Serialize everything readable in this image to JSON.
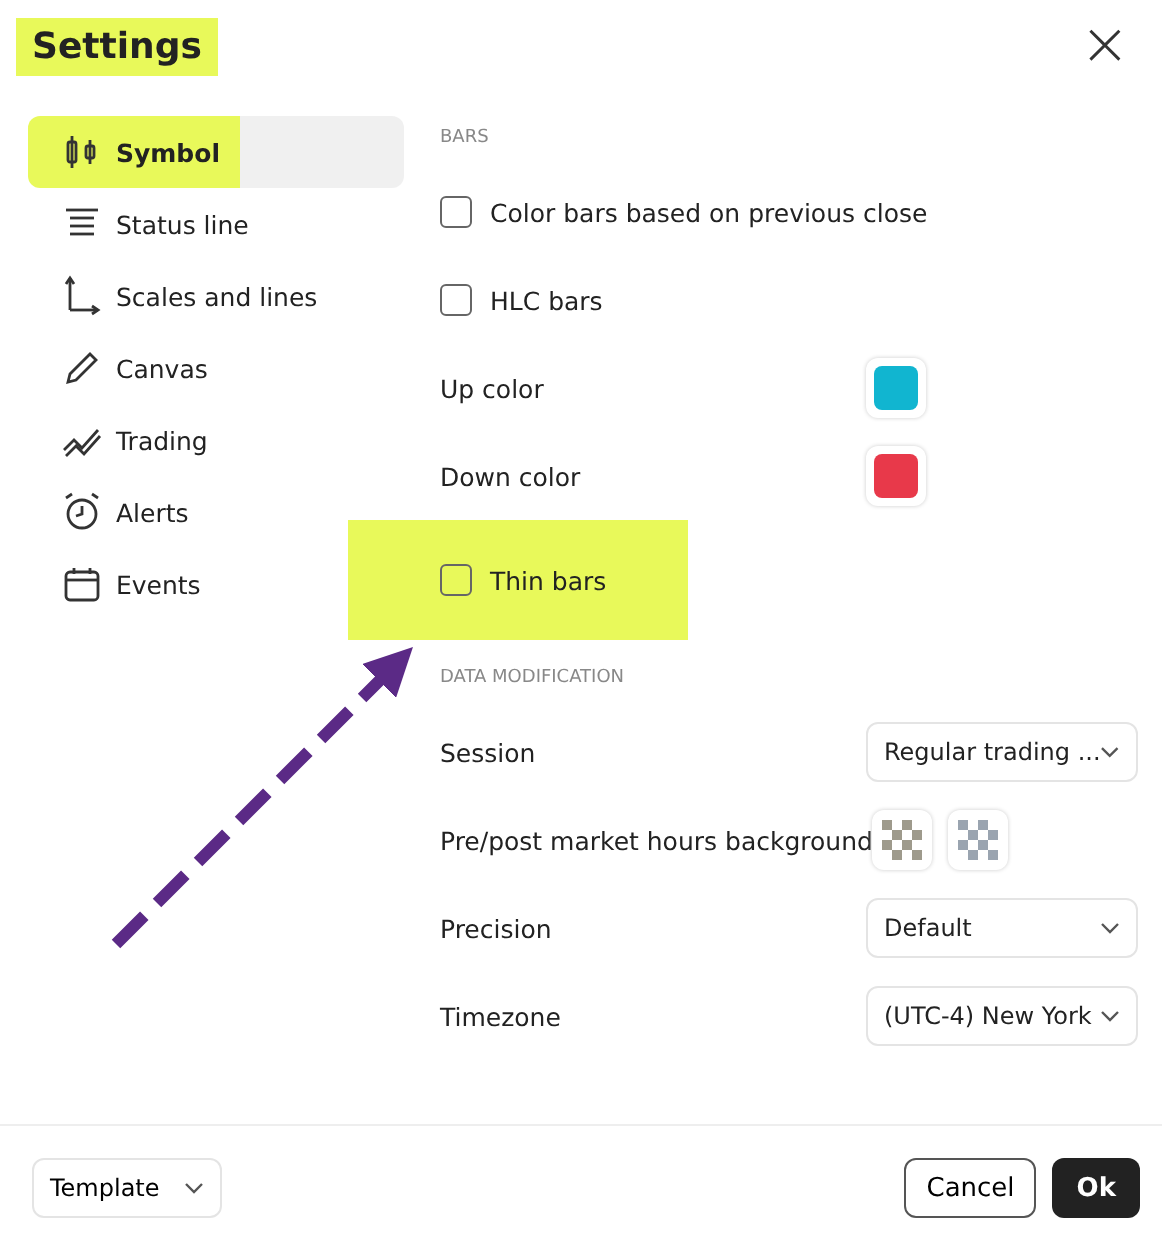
{
  "window": {
    "title": "Settings",
    "title_highlighted": true,
    "close": "×"
  },
  "sidebar": {
    "items": [
      {
        "label": "Symbol",
        "selected": true,
        "highlighted": true
      },
      {
        "label": "Status line",
        "selected": false,
        "highlighted": false
      },
      {
        "label": "Scales and lines",
        "selected": false,
        "highlighted": false
      },
      {
        "label": "Canvas",
        "selected": false,
        "highlighted": false
      },
      {
        "label": "Trading",
        "selected": false,
        "highlighted": false
      },
      {
        "label": "Alerts",
        "selected": false,
        "highlighted": false
      },
      {
        "label": "Events",
        "selected": false,
        "highlighted": false
      }
    ]
  },
  "sections": [
    {
      "heading": "BARS",
      "rows": [
        {
          "kind": "checkbox",
          "label": "Color bars based on previous close",
          "checked": false,
          "highlighted": false
        },
        {
          "kind": "checkbox",
          "label": "HLC bars",
          "checked": false,
          "highlighted": false
        },
        {
          "kind": "color",
          "label": "Up color",
          "color": "#11b5d0"
        },
        {
          "kind": "color",
          "label": "Down color",
          "color": "#e8394a"
        },
        {
          "kind": "checkbox",
          "label": "Thin bars",
          "checked": false,
          "highlighted": true
        }
      ]
    },
    {
      "heading": "DATA MODIFICATION",
      "rows": [
        {
          "kind": "select",
          "label": "Session",
          "value": "Regular trading ..."
        },
        {
          "kind": "patterns",
          "label": "Pre/post market hours background"
        },
        {
          "kind": "select",
          "label": "Precision",
          "value": "Default"
        },
        {
          "kind": "select",
          "label": "Timezone",
          "value": "(UTC-4) New York"
        }
      ]
    }
  ],
  "footer": {
    "template": "Template",
    "cancel": "Cancel",
    "ok": "Ok"
  },
  "annotation_arrow": true
}
